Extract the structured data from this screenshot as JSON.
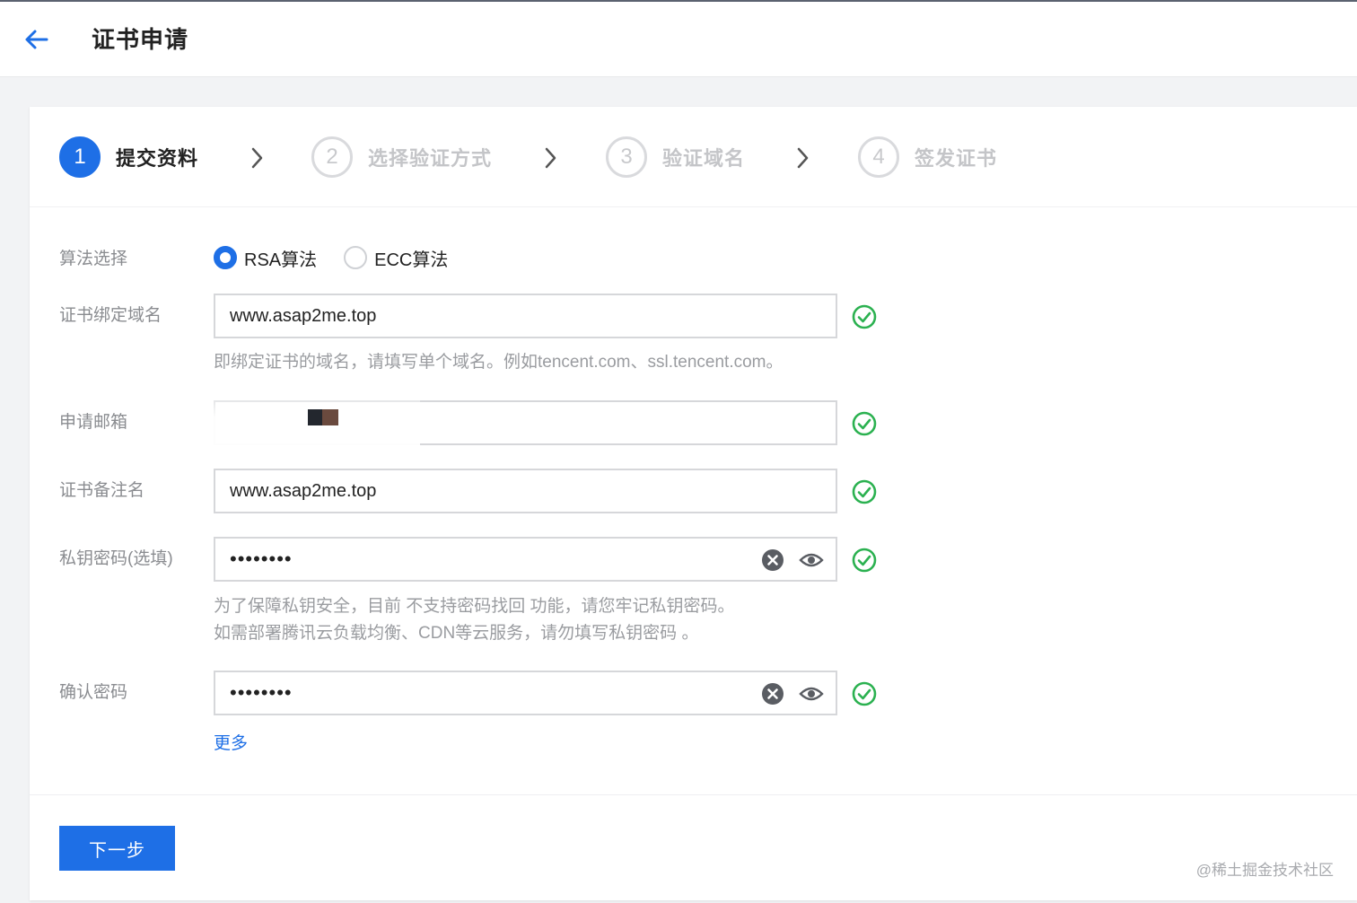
{
  "header": {
    "title": "证书申请",
    "back_icon": "arrow-left-icon"
  },
  "steps": [
    {
      "number": "1",
      "label": "提交资料",
      "active": true
    },
    {
      "number": "2",
      "label": "选择验证方式",
      "active": false
    },
    {
      "number": "3",
      "label": "验证域名",
      "active": false
    },
    {
      "number": "4",
      "label": "签发证书",
      "active": false
    }
  ],
  "form": {
    "algorithm": {
      "label": "算法选择",
      "options": [
        {
          "label": "RSA算法",
          "checked": true
        },
        {
          "label": "ECC算法",
          "checked": false
        }
      ]
    },
    "domain": {
      "label": "证书绑定域名",
      "value": "www.asap2me.top",
      "hint": "即绑定证书的域名，请填写单个域名。例如tencent.com、ssl.tencent.com。"
    },
    "email": {
      "label": "申请邮箱",
      "value": ""
    },
    "remark": {
      "label": "证书备注名",
      "value": "www.asap2me.top"
    },
    "private_key_password": {
      "label": "私钥密码(选填)",
      "value": "••••••••",
      "hint_line1": "为了保障私钥安全，目前 不支持密码找回 功能，请您牢记私钥密码。",
      "hint_line2": "如需部署腾讯云负载均衡、CDN等云服务，请勿填写私钥密码 。"
    },
    "confirm_password": {
      "label": "确认密码",
      "value": "••••••••"
    },
    "more_link": "更多"
  },
  "actions": {
    "next_label": "下一步"
  },
  "watermark": "@稀土掘金技术社区",
  "colors": {
    "primary": "#1e6fe6",
    "success": "#2bb150",
    "muted": "#8a8c90"
  }
}
